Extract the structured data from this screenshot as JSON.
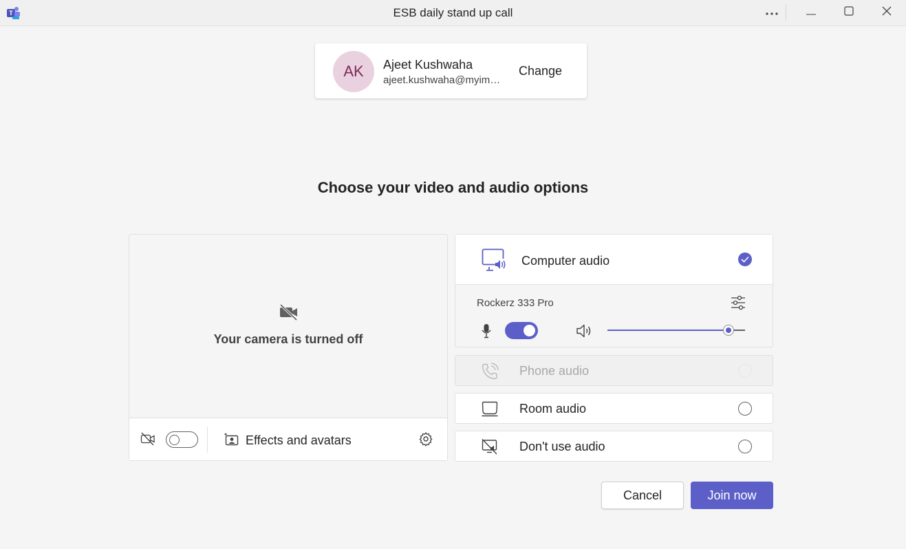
{
  "window": {
    "title": "ESB daily stand up call",
    "app_icon": "teams-icon",
    "controls": [
      "more-icon",
      "minimize-icon",
      "maximize-icon",
      "close-icon"
    ]
  },
  "account": {
    "initials": "AK",
    "name": "Ajeet Kushwaha",
    "email": "ajeet.kushwaha@myimsaas.com",
    "change_label": "Change"
  },
  "heading": "Choose your video and audio options",
  "video": {
    "camera_off_text": "Your camera is turned off",
    "camera_on": false,
    "effects_label": "Effects and avatars"
  },
  "audio": {
    "computer_audio_label": "Computer audio",
    "computer_audio_selected": true,
    "device_name": "Rockerz 333 Pro",
    "mic_on": true,
    "volume": 0.88,
    "options": [
      {
        "label": "Phone audio",
        "icon": "phone-icon",
        "disabled": true
      },
      {
        "label": "Room audio",
        "icon": "room-icon",
        "disabled": false
      },
      {
        "label": "Don't use audio",
        "icon": "no-audio-icon",
        "disabled": false
      }
    ]
  },
  "actions": {
    "cancel_label": "Cancel",
    "join_label": "Join now"
  },
  "colors": {
    "accent": "#5b5fc7",
    "avatar_bg": "#ead1df",
    "avatar_fg": "#7a2b57"
  }
}
